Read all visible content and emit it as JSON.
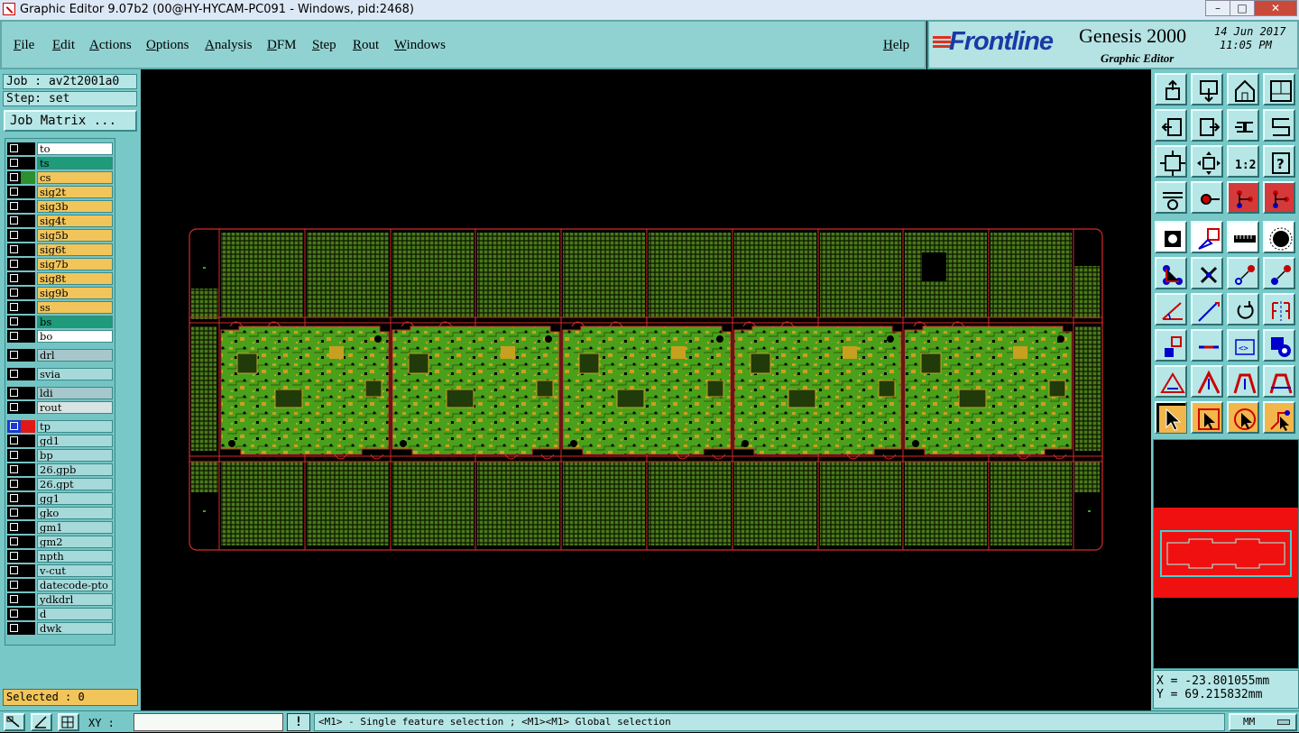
{
  "window": {
    "title": "Graphic Editor 9.07b2 (00@HY-HYCAM-PC091 - Windows, pid:2468)",
    "controls": {
      "minimize": "–",
      "maximize": "□",
      "close": "✕"
    }
  },
  "menu": {
    "items": [
      "File",
      "Edit",
      "Actions",
      "Options",
      "Analysis",
      "DFM",
      "Step",
      "Rout",
      "Windows"
    ],
    "help": "Help"
  },
  "branding": {
    "logo": "Frontline",
    "product": "Genesis 2000",
    "subtitle": "Graphic Editor",
    "date": "14 Jun 2017",
    "time": "11:05 PM"
  },
  "job": {
    "job_label": "Job : av2t2001a0",
    "step_label": "Step: set",
    "matrix_button": "Job Matrix ..."
  },
  "layers": {
    "group1": [
      {
        "name": "to",
        "color": "#ffffff",
        "swatch": "#000000"
      },
      {
        "name": "ts",
        "color": "#1f9a7a",
        "swatch": "#000000"
      },
      {
        "name": "cs",
        "color": "#f2c55a",
        "swatch": "#2e8f2e"
      },
      {
        "name": "sig2t",
        "color": "#f2c55a",
        "swatch": "#000000"
      },
      {
        "name": "sig3b",
        "color": "#f2c55a",
        "swatch": "#000000"
      },
      {
        "name": "sig4t",
        "color": "#f2c55a",
        "swatch": "#000000"
      },
      {
        "name": "sig5b",
        "color": "#f2c55a",
        "swatch": "#000000"
      },
      {
        "name": "sig6t",
        "color": "#f2c55a",
        "swatch": "#000000"
      },
      {
        "name": "sig7b",
        "color": "#f2c55a",
        "swatch": "#000000"
      },
      {
        "name": "sig8t",
        "color": "#f2c55a",
        "swatch": "#000000"
      },
      {
        "name": "sig9b",
        "color": "#f2c55a",
        "swatch": "#000000"
      },
      {
        "name": "ss",
        "color": "#f2c55a",
        "swatch": "#000000"
      },
      {
        "name": "bs",
        "color": "#1f9a7a",
        "swatch": "#000000"
      },
      {
        "name": "bo",
        "color": "#ffffff",
        "swatch": "#000000"
      }
    ],
    "group2": [
      {
        "name": "drl",
        "color": "#a6c8cc",
        "swatch": "#000000"
      }
    ],
    "group3": [
      {
        "name": "svia",
        "color": "#a6dada",
        "swatch": "#000000"
      }
    ],
    "group4": [
      {
        "name": "ldi",
        "color": "#a6c8cc",
        "swatch": "#000000"
      },
      {
        "name": "rout",
        "color": "#d8e4e4",
        "swatch": "#000000"
      }
    ],
    "group5": [
      {
        "name": "tp",
        "color": "#a6dada",
        "swatch": "#e01818",
        "active": true
      },
      {
        "name": "gd1",
        "color": "#a6dada",
        "swatch": "#000000"
      },
      {
        "name": "bp",
        "color": "#a6dada",
        "swatch": "#000000"
      },
      {
        "name": "26.gpb",
        "color": "#a6dada",
        "swatch": "#000000"
      },
      {
        "name": "26.gpt",
        "color": "#a6dada",
        "swatch": "#000000"
      },
      {
        "name": "gg1",
        "color": "#a6dada",
        "swatch": "#000000"
      },
      {
        "name": "gko",
        "color": "#a6dada",
        "swatch": "#000000"
      },
      {
        "name": "gm1",
        "color": "#a6dada",
        "swatch": "#000000"
      },
      {
        "name": "gm2",
        "color": "#a6dada",
        "swatch": "#000000"
      },
      {
        "name": "npth",
        "color": "#a6dada",
        "swatch": "#000000"
      },
      {
        "name": "v-cut",
        "color": "#a6dada",
        "swatch": "#000000"
      },
      {
        "name": "datecode-pto",
        "color": "#a6dada",
        "swatch": "#000000"
      },
      {
        "name": "ydkdrl",
        "color": "#a6dada",
        "swatch": "#000000"
      },
      {
        "name": "d",
        "color": "#a6dada",
        "swatch": "#000000"
      },
      {
        "name": "dwk",
        "color": "#a6dada",
        "swatch": "#000000"
      }
    ]
  },
  "selection": {
    "label": "Selected : 0"
  },
  "toolbar": {
    "buttons": [
      [
        "export-icon",
        "open-icon",
        "home-icon",
        "window-icon"
      ],
      [
        "zoom-in-left-icon",
        "zoom-in-right-icon",
        "swap-icon",
        "snake-icon"
      ],
      [
        "fit-icon",
        "center-icon",
        "ratio-icon",
        "help-icon"
      ],
      [
        "settings-icon",
        "pin-icon",
        "graph-icon",
        "graph-alt-icon"
      ],
      [
        "pad-icon",
        "edit-shape-icon",
        "ruler-icon",
        "stamp-icon"
      ],
      [
        "connect-icon",
        "cross-icon",
        "move-point-icon",
        "move-point-alt-icon"
      ],
      [
        "angle-icon",
        "line-icon",
        "rotate-icon",
        "mirror-icon"
      ],
      [
        "copy-icon",
        "segment-icon",
        "resize-icon",
        "merge-icon"
      ],
      [
        "triangle-icon",
        "arc-icon",
        "arc-alt-icon",
        "arc-flip-icon"
      ],
      [
        "select-arrow-icon",
        "select-box-icon",
        "select-round-icon",
        "select-multi-icon"
      ]
    ],
    "ratio_label": "1:2",
    "help_label": "?"
  },
  "coords": {
    "x": "X = -23.801055mm",
    "y": "Y = 69.215832mm"
  },
  "bottom": {
    "xy_label": "XY :",
    "xy_value": "",
    "excl": "!",
    "status": "<M1> - Single feature selection ; <M1><M1> Global selection",
    "units": "MM"
  },
  "colors": {
    "board_red": "#d42a2a",
    "copper_green": "#4a7a1a",
    "pcb_green": "#4aa01a",
    "pad_yellow": "#c8a020",
    "panel_teal": "#78c8c8"
  }
}
